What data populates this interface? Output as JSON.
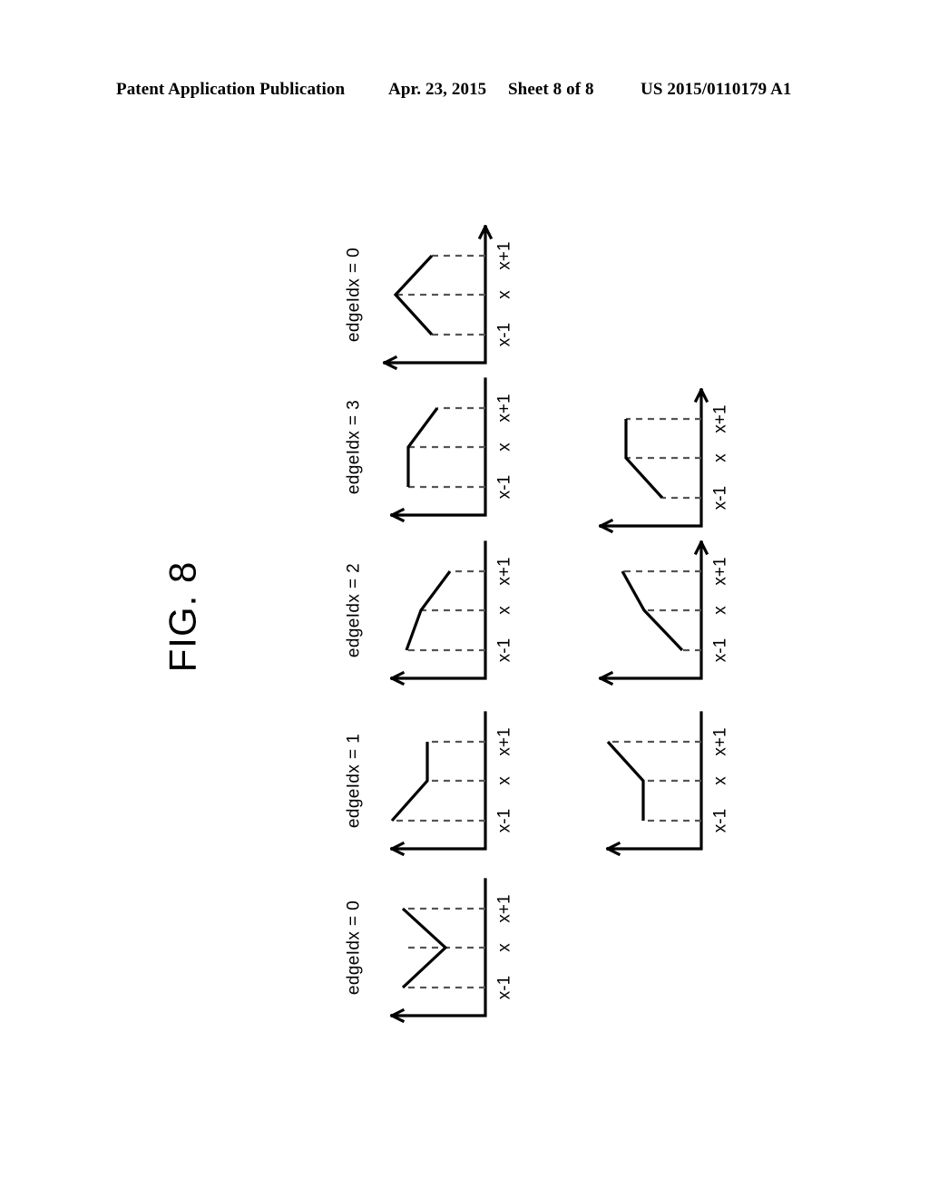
{
  "header": {
    "publication": "Patent Application Publication",
    "date": "Apr. 23, 2015",
    "sheet": "Sheet 8 of 8",
    "number": "US 2015/0110179 A1"
  },
  "figure": {
    "label": "FIG. 8",
    "orientation": "rotated-90-ccw"
  },
  "axis": {
    "tick_labels": [
      "x-1",
      "x",
      "x+1"
    ],
    "arrow_direction_label": "value-axis-arrow"
  },
  "chart_data": {
    "type": "line",
    "title": "FIG. 8",
    "xlabel": "",
    "ylabel": "",
    "x": [
      "x-1",
      "x",
      "x+1"
    ],
    "ylim": [
      0,
      3
    ],
    "grid": false,
    "legend": "none",
    "note": "Each panel plots the sample value at positions x-1, x, x+1 relative to dashed reference levels; panels are drawn rotated 90 degrees counter-clockwise on the page.",
    "series": [
      {
        "name": "edgeIdx = 0 (top row, peak)",
        "edgeIdx": 0,
        "row": "top",
        "col": 1,
        "label": "edgeIdx = 0",
        "values": [
          1,
          0,
          1
        ],
        "shape": "valley"
      },
      {
        "name": "edgeIdx = 1 (top row)",
        "edgeIdx": 1,
        "row": "top",
        "col": 2,
        "label": "edgeIdx = 1",
        "values": [
          2,
          1,
          1
        ],
        "shape": "down-then-flat-step"
      },
      {
        "name": "edgeIdx = 2 (top row)",
        "edgeIdx": 2,
        "row": "top",
        "col": 3,
        "label": "edgeIdx = 2",
        "values": [
          2,
          1.4,
          0.6
        ],
        "shape": "monotonic-decreasing"
      },
      {
        "name": "edgeIdx = 3 (top row)",
        "edgeIdx": 3,
        "row": "top",
        "col": 4,
        "label": "edgeIdx = 3",
        "values": [
          1.6,
          1.6,
          0.6
        ],
        "shape": "flat-then-down"
      },
      {
        "name": "edgeIdx = 0 (top row, far right, peak)",
        "edgeIdx": 0,
        "row": "top",
        "col": 5,
        "label": "edgeIdx = 0",
        "values": [
          1,
          2,
          1
        ],
        "shape": "peak"
      },
      {
        "name": "edgeIdx = 1 (bottom row)",
        "edgeIdx": 1,
        "row": "bottom",
        "col": 2,
        "label": "",
        "values": [
          1,
          1,
          2
        ],
        "shape": "flat-step-then-up"
      },
      {
        "name": "edgeIdx = 2 (bottom row)",
        "edgeIdx": 2,
        "row": "bottom",
        "col": 3,
        "label": "",
        "values": [
          0.6,
          1.4,
          2
        ],
        "shape": "monotonic-increasing"
      },
      {
        "name": "edgeIdx = 3 (bottom row)",
        "edgeIdx": 3,
        "row": "bottom",
        "col": 4,
        "label": "",
        "values": [
          0.6,
          1.6,
          1.6
        ],
        "shape": "up-then-flat"
      }
    ]
  }
}
